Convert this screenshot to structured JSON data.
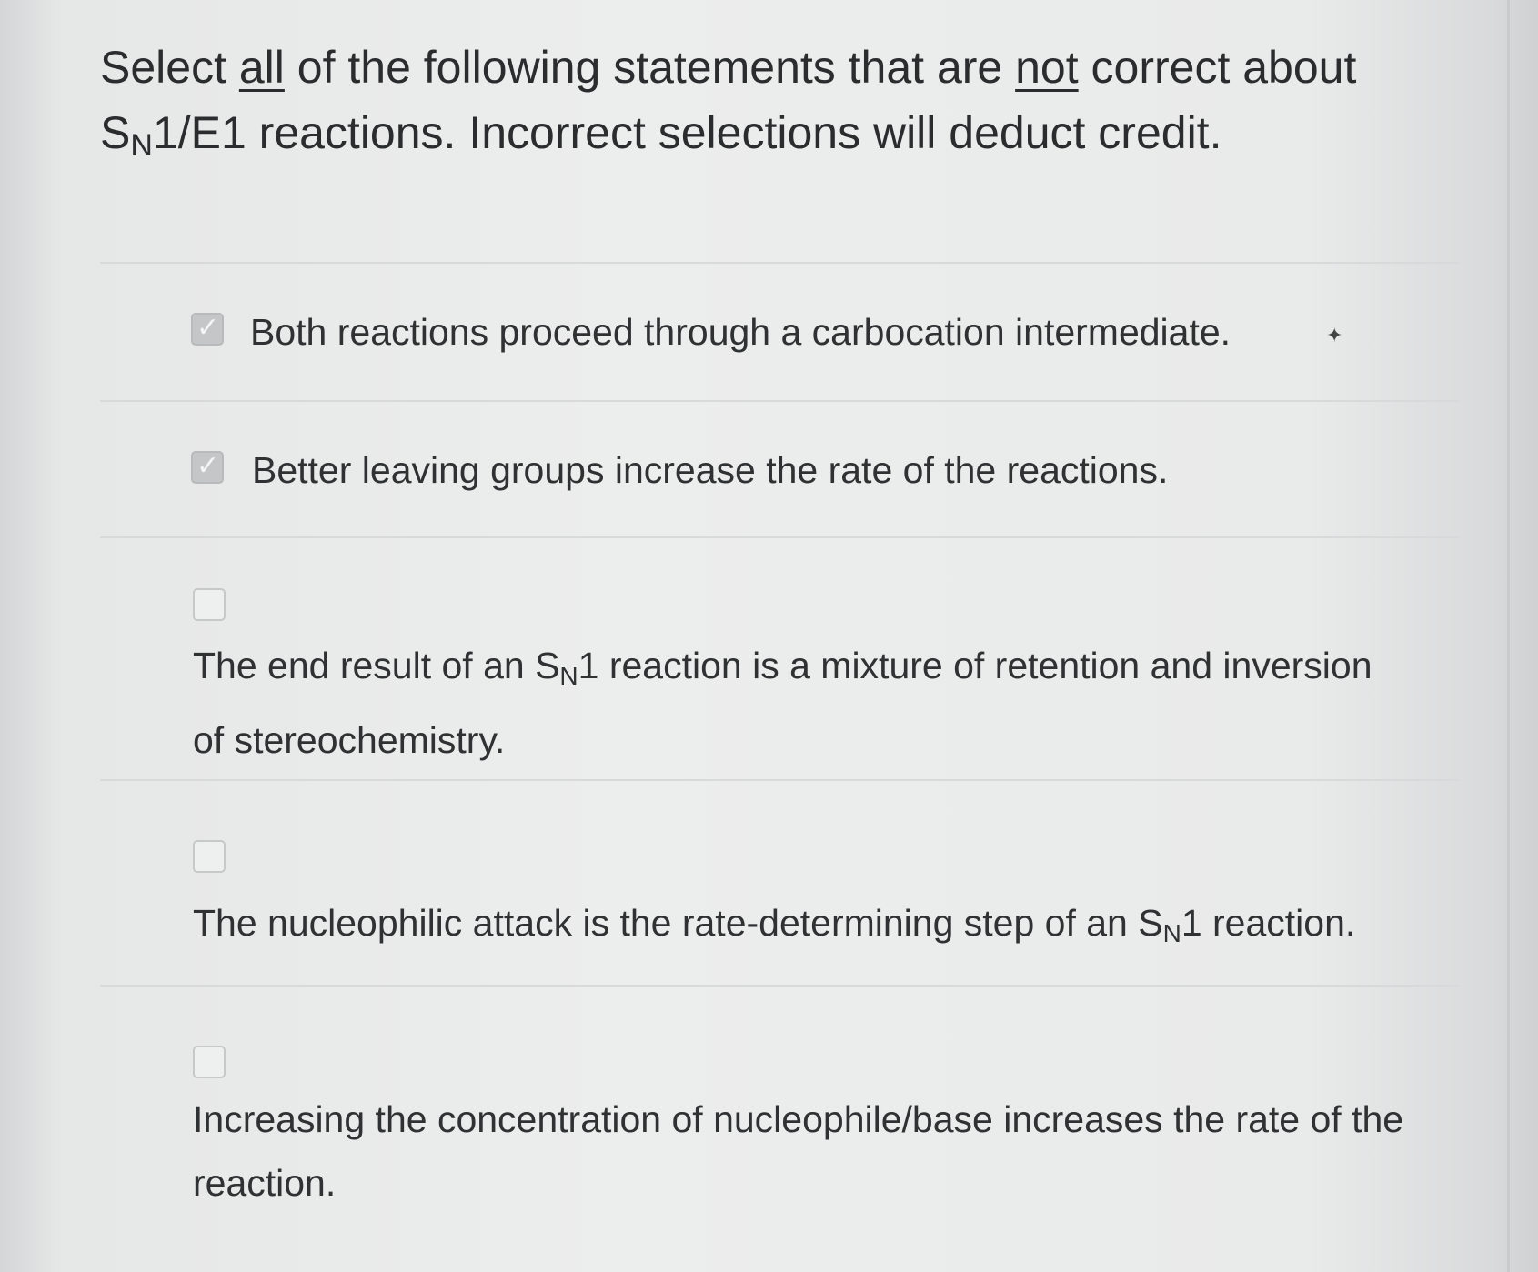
{
  "question": {
    "part1": "Select ",
    "all": "all",
    "part2": " of the following statements that are ",
    "not": "not",
    "part3": " correct about",
    "sn_s": "S",
    "sn_n": "N",
    "part4": "1/E1 reactions. Incorrect selections will deduct credit."
  },
  "options": [
    {
      "checked": true,
      "text": "Both reactions proceed through a carbocation intermediate."
    },
    {
      "checked": true,
      "text": "Better leaving groups increase the rate of the reactions."
    },
    {
      "checked": false,
      "pre": "The end result of an S",
      "sub": "N",
      "post": "1 reaction is a mixture of retention and inversion of stereochemistry."
    },
    {
      "checked": false,
      "pre": "The nucleophilic attack is the rate-determining step of an S",
      "sub": "N",
      "post": "1 reaction."
    },
    {
      "checked": false,
      "text": "Increasing the concentration of nucleophile/base increases the rate of the reaction."
    }
  ],
  "check_glyph": "✓"
}
